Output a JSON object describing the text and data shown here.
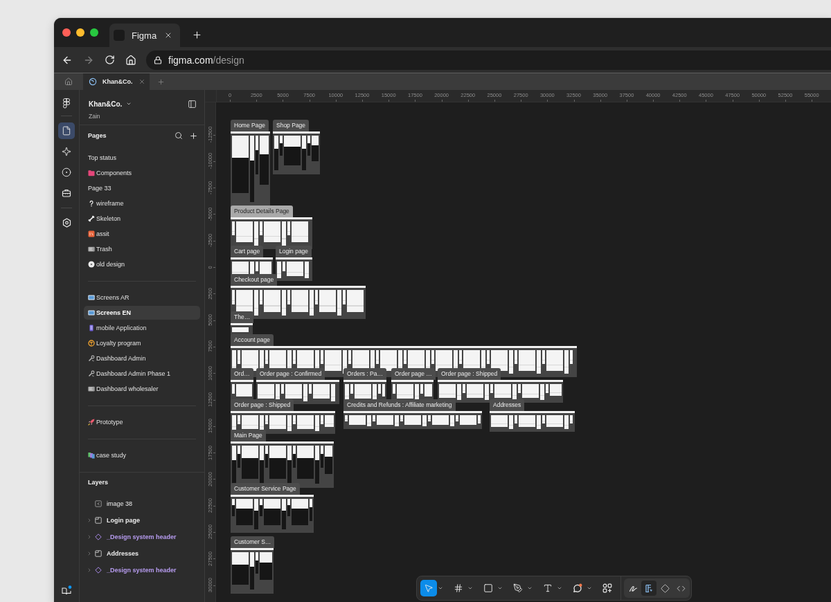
{
  "browser": {
    "tab": {
      "title": "Figma"
    },
    "back": {
      "disabled": false
    },
    "forward": {
      "disabled": true
    },
    "address": {
      "host": "figma.com",
      "path": "/design"
    }
  },
  "file_tabs": [
    {
      "label": "Khan&Co.",
      "selected": true
    }
  ],
  "rail": {
    "tools": [
      {
        "selected": true
      },
      {
        "selected": false
      },
      {
        "selected": false
      },
      {
        "selected": false
      },
      {
        "selected": false
      }
    ]
  },
  "sidebar": {
    "file_name": "Khan&Co.",
    "team": "Zain",
    "pages": {
      "title": "Pages",
      "groups": [
        {
          "items": [
            {
              "label": "Top status",
              "selected": false
            },
            {
              "label": "Components",
              "selected": false
            },
            {
              "label": "Page 33",
              "selected": false
            },
            {
              "label": "wireframe",
              "selected": false
            },
            {
              "label": "Skeleton",
              "selected": false
            },
            {
              "label": "assit",
              "selected": false
            },
            {
              "label": "Trash",
              "selected": false
            },
            {
              "label": "old design",
              "selected": false
            }
          ]
        },
        {
          "items": [
            {
              "label": "Screens AR",
              "selected": false
            },
            {
              "label": "Screens EN",
              "selected": true
            },
            {
              "label": "mobile Application",
              "selected": false
            },
            {
              "label": "Loyalty program",
              "selected": false
            },
            {
              "label": "Dashboard Admin",
              "selected": false
            },
            {
              "label": "Dashboard Admin Phase 1",
              "selected": false
            },
            {
              "label": "Dashboard wholesaler",
              "selected": false
            }
          ]
        },
        {
          "items": [
            {
              "label": "Prototype",
              "selected": false
            }
          ]
        },
        {
          "items": [
            {
              "label": "case study",
              "selected": false
            }
          ]
        }
      ]
    },
    "layers": {
      "title": "Layers",
      "items": [
        {
          "label": "image 38",
          "kind": "image"
        },
        {
          "label": "Login page",
          "kind": "frame",
          "expanded": false
        },
        {
          "label": "_Design system header",
          "kind": "instance",
          "expanded": false
        },
        {
          "label": "Addresses",
          "kind": "frame",
          "expanded": false
        },
        {
          "label": "_Design system header",
          "kind": "instance",
          "expanded": false
        }
      ]
    }
  },
  "rulers": {
    "horizontal": [
      "0",
      "2500",
      "5000",
      "7500",
      "10000",
      "12500",
      "15000",
      "17500",
      "20000",
      "22500",
      "25000",
      "27500",
      "30000",
      "32500",
      "35000",
      "37500",
      "40000",
      "42500",
      "45000",
      "47500",
      "50000",
      "52500",
      "55000"
    ],
    "vertical": [
      "-12500",
      "-10000",
      "-7500",
      "-5000",
      "-2500",
      "0",
      "2500",
      "5000",
      "7500",
      "10000",
      "12500",
      "15000",
      "17500",
      "20000",
      "22500",
      "25000",
      "27500",
      "30000"
    ]
  },
  "canvas": {
    "sections": [
      {
        "label": "Home Page",
        "selected": false
      },
      {
        "label": "Shop Page",
        "selected": false
      },
      {
        "label": "Product Details Page",
        "selected": true
      },
      {
        "label": "Cart page",
        "selected": false
      },
      {
        "label": "Login page",
        "selected": false
      },
      {
        "label": "Checkout page",
        "selected": false
      },
      {
        "label": "The…",
        "selected": false
      },
      {
        "label": "Account page",
        "selected": false
      },
      {
        "label": "Ord…",
        "selected": false
      },
      {
        "label": "Order page : Confirmed",
        "selected": false
      },
      {
        "label": "Orders : Pa…",
        "selected": false
      },
      {
        "label": "Order page …",
        "selected": false
      },
      {
        "label": "Order page : Shipped",
        "selected": false
      },
      {
        "label": "Order page : Shipped",
        "selected": false
      },
      {
        "label": "Credits and Refunds : Affiliate marketing",
        "selected": false
      },
      {
        "label": "Addresses",
        "selected": false
      },
      {
        "label": "Main Page",
        "selected": false
      },
      {
        "label": "Customer Service Page",
        "selected": false
      },
      {
        "label": "Customer S…",
        "selected": false
      }
    ]
  },
  "toolbar": {
    "tools": [
      {
        "selected": true
      },
      {
        "selected": false
      },
      {
        "selected": false
      },
      {
        "selected": false
      },
      {
        "selected": false
      },
      {
        "selected": false
      }
    ],
    "modes": [
      {
        "selected": false
      },
      {
        "selected": true
      },
      {
        "selected": false
      },
      {
        "selected": false
      }
    ]
  }
}
